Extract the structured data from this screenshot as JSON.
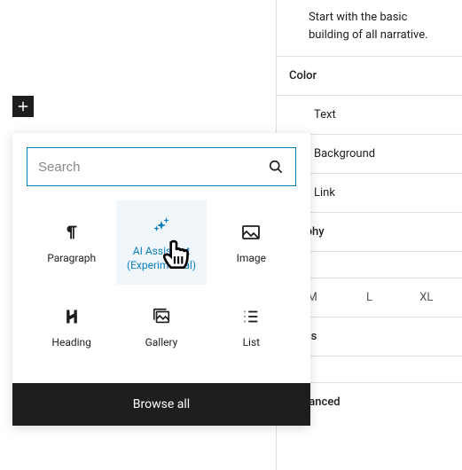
{
  "inserter": {
    "search_placeholder": "Search",
    "blocks": [
      {
        "label": "Paragraph"
      },
      {
        "label": "AI Assistant (Experimental)"
      },
      {
        "label": "Image"
      },
      {
        "label": "Heading"
      },
      {
        "label": "Gallery"
      },
      {
        "label": "List"
      }
    ],
    "browse_all": "Browse all"
  },
  "sidebar": {
    "description": "Start with the basic building of all narrative.",
    "sections": {
      "color": {
        "heading": "Color",
        "items": [
          "Text",
          "Background",
          "Link"
        ]
      },
      "typography": {
        "heading": "graphy",
        "sizes": [
          "M",
          "L",
          "XL"
        ]
      },
      "dimensions": {
        "heading": "sions"
      },
      "advanced": {
        "heading": "Advanced"
      }
    }
  }
}
